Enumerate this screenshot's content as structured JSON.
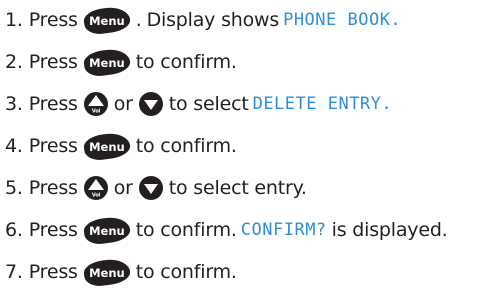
{
  "icons": {
    "menu": "menu-button-icon",
    "vol_up": "volume-up-button-icon",
    "down": "down-arrow-button-icon"
  },
  "colors": {
    "lcd_text": "#2f8fd6",
    "button_fill": "#231f20",
    "body_text": "#231f20"
  },
  "buttons": {
    "menu_label": "Menu",
    "vol_label": "Vol"
  },
  "steps": [
    {
      "num": "1.",
      "press": "Press",
      "after": ".",
      "text2": "Display shows",
      "display": "PHONE BOOK."
    },
    {
      "num": "2.",
      "press": "Press",
      "after": "to confirm."
    },
    {
      "num": "3.",
      "press": "Press",
      "or": "or",
      "after": "to select",
      "display": "DELETE ENTRY."
    },
    {
      "num": "4.",
      "press": "Press",
      "after": "to confirm."
    },
    {
      "num": "5.",
      "press": "Press",
      "or": "or",
      "after": "to select entry."
    },
    {
      "num": "6.",
      "press": "Press",
      "after": "to confirm.",
      "display": "CONFIRM?",
      "text3": "is displayed."
    },
    {
      "num": "7.",
      "press": "Press",
      "after": "to confirm."
    }
  ]
}
